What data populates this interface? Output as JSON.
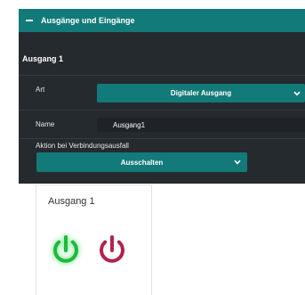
{
  "panel": {
    "header_title": "Ausgänge und Eingänge",
    "section_title": "Ausgang 1",
    "rows": {
      "art": {
        "label": "Art",
        "selected": "Digitaler Ausgang"
      },
      "name": {
        "label": "Name",
        "value": "Ausgang1"
      },
      "aktion": {
        "label": "Aktion bei Verbindungsausfall",
        "selected": "Ausschalten"
      }
    }
  },
  "card": {
    "title": "Ausgang 1",
    "on_button_icon": "power-icon",
    "off_button_icon": "power-icon"
  },
  "colors": {
    "header": "#127a78",
    "panel_bg": "#252a2f",
    "select_bg": "#127a78",
    "power_on": "#1cba3c",
    "power_off": "#b0234a"
  }
}
